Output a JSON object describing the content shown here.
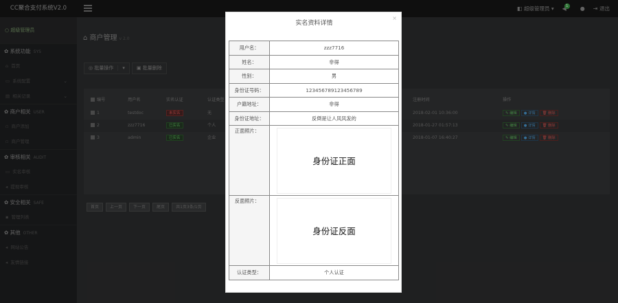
{
  "topbar": {
    "brand": "CC聚合支付系统V2.0",
    "account_label": "超级管理员 ▾",
    "notify_count": "1",
    "logout_label": "退出"
  },
  "sidebar": {
    "user": "超级管理员",
    "sections": [
      {
        "title": "系统功能",
        "sub": "SYS",
        "items": [
          {
            "label": "首页"
          },
          {
            "label": "系统配置",
            "has_children": true
          },
          {
            "label": "相关记录",
            "has_children": true
          }
        ]
      },
      {
        "title": "商户相关",
        "sub": "USER",
        "items": [
          {
            "label": "商户添加"
          },
          {
            "label": "商户管理"
          }
        ]
      },
      {
        "title": "审核相关",
        "sub": "AUDIT",
        "items": [
          {
            "label": "实名审核"
          },
          {
            "label": "提现审核"
          }
        ]
      },
      {
        "title": "安全相关",
        "sub": "SAFE",
        "items": [
          {
            "label": "管理列表"
          }
        ]
      },
      {
        "title": "其他",
        "sub": "OTHER",
        "items": [
          {
            "label": "网站公告"
          },
          {
            "label": "友情链接"
          }
        ]
      }
    ]
  },
  "main": {
    "title": "商户管理",
    "version": "v 2.0",
    "toolbar": {
      "batch_label": "批量操作",
      "delete_label": "批量删除"
    },
    "table": {
      "headers": [
        "编号",
        "用户名",
        "实名认证",
        "认证类型",
        "注册时间",
        "操作"
      ],
      "rows": [
        {
          "id": "1",
          "user": "testdoc",
          "auth": "未实名",
          "auth_color": "red",
          "type": "无",
          "time": "2018-02-01 10:36:00"
        },
        {
          "id": "2",
          "user": "zzz7716",
          "auth": "已实名",
          "auth_color": "green",
          "type": "个人",
          "time": "2018-01-27 01:57:13"
        },
        {
          "id": "3",
          "user": "admin",
          "auth": "已实名",
          "auth_color": "green",
          "type": "企业",
          "time": "2018-01-07 16:40:27"
        }
      ],
      "action_labels": {
        "edit": "✎ 编辑",
        "view": "● 详情",
        "delete": "🗑 删除"
      }
    },
    "pager": [
      "首页",
      "上一页",
      "下一页",
      "尾页",
      "共1页3条/1页"
    ]
  },
  "modal": {
    "title": "实名资料详情",
    "close": "×",
    "rows": [
      {
        "label": "用户名：",
        "value": "zzz7716"
      },
      {
        "label": "姓名：",
        "value": "非得"
      },
      {
        "label": "性别：",
        "value": "男"
      },
      {
        "label": "身份证号码：",
        "value": "123456789123456789"
      },
      {
        "label": "户籍地址：",
        "value": "非得"
      },
      {
        "label": "身份证地址：",
        "value": "反倒是让人风风发的"
      }
    ],
    "front_label": "正面照片：",
    "front_image_text": "身份证正面",
    "back_label": "反面照片：",
    "back_image_text": "身份证反面",
    "type_label": "认证类型：",
    "type_value": "个人认证"
  }
}
